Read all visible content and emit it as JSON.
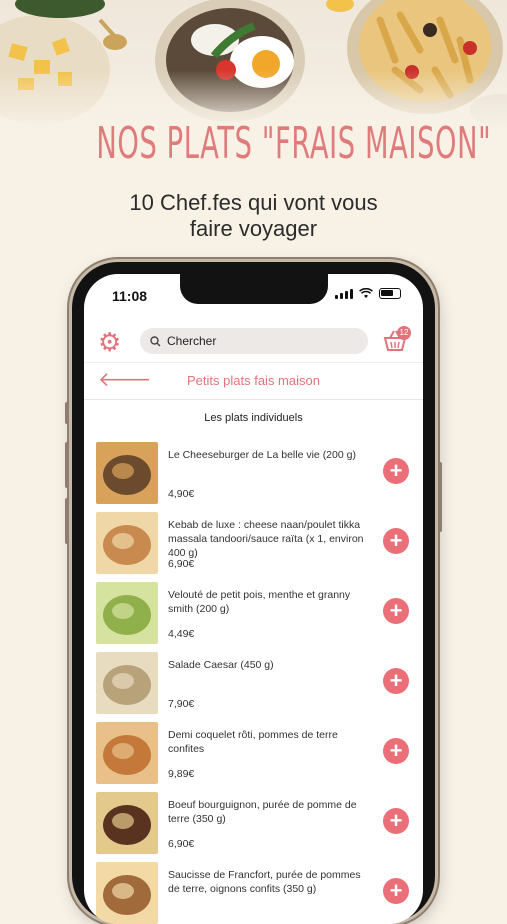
{
  "headline": "NOS PLATS \"FRAIS MAISON\"",
  "subline": [
    "10 Chef.fes qui vont vous",
    "faire voyager"
  ],
  "status": {
    "time": "11:08"
  },
  "search": {
    "placeholder": "Chercher"
  },
  "cart": {
    "count": "12"
  },
  "nav": {
    "title": "Petits plats fais maison"
  },
  "section_title": "Les plats individuels",
  "items": [
    {
      "name": "Le Cheeseburger de La belle vie (200 g)",
      "price": "4,90€",
      "colors": [
        "#6b4a2e",
        "#d9a25a"
      ]
    },
    {
      "name": "Kebab de luxe : cheese naan/poulet tikka massala tandoori/sauce raïta (x 1, environ 400 g)",
      "price": "6,90€",
      "colors": [
        "#c98a4f",
        "#f0d7a8"
      ]
    },
    {
      "name": "Velouté de petit pois, menthe et granny smith (200 g)",
      "price": "4,49€",
      "colors": [
        "#8fb04a",
        "#d6e2a0"
      ]
    },
    {
      "name": "Salade Caesar (450 g)",
      "price": "7,90€",
      "colors": [
        "#b8a27a",
        "#e8dcc0"
      ]
    },
    {
      "name": "Demi coquelet rôti, pommes de terre confites",
      "price": "9,89€",
      "colors": [
        "#c4793b",
        "#e9c08a"
      ]
    },
    {
      "name": "Boeuf bourguignon, purée de pomme de terre (350 g)",
      "price": "6,90€",
      "colors": [
        "#5a3220",
        "#e3c98c"
      ]
    },
    {
      "name": "Saucisse de Francfort, purée de pommes de terre, oignons confits (350 g)",
      "price": "",
      "colors": [
        "#a06a3a",
        "#f2d9a6"
      ]
    }
  ]
}
